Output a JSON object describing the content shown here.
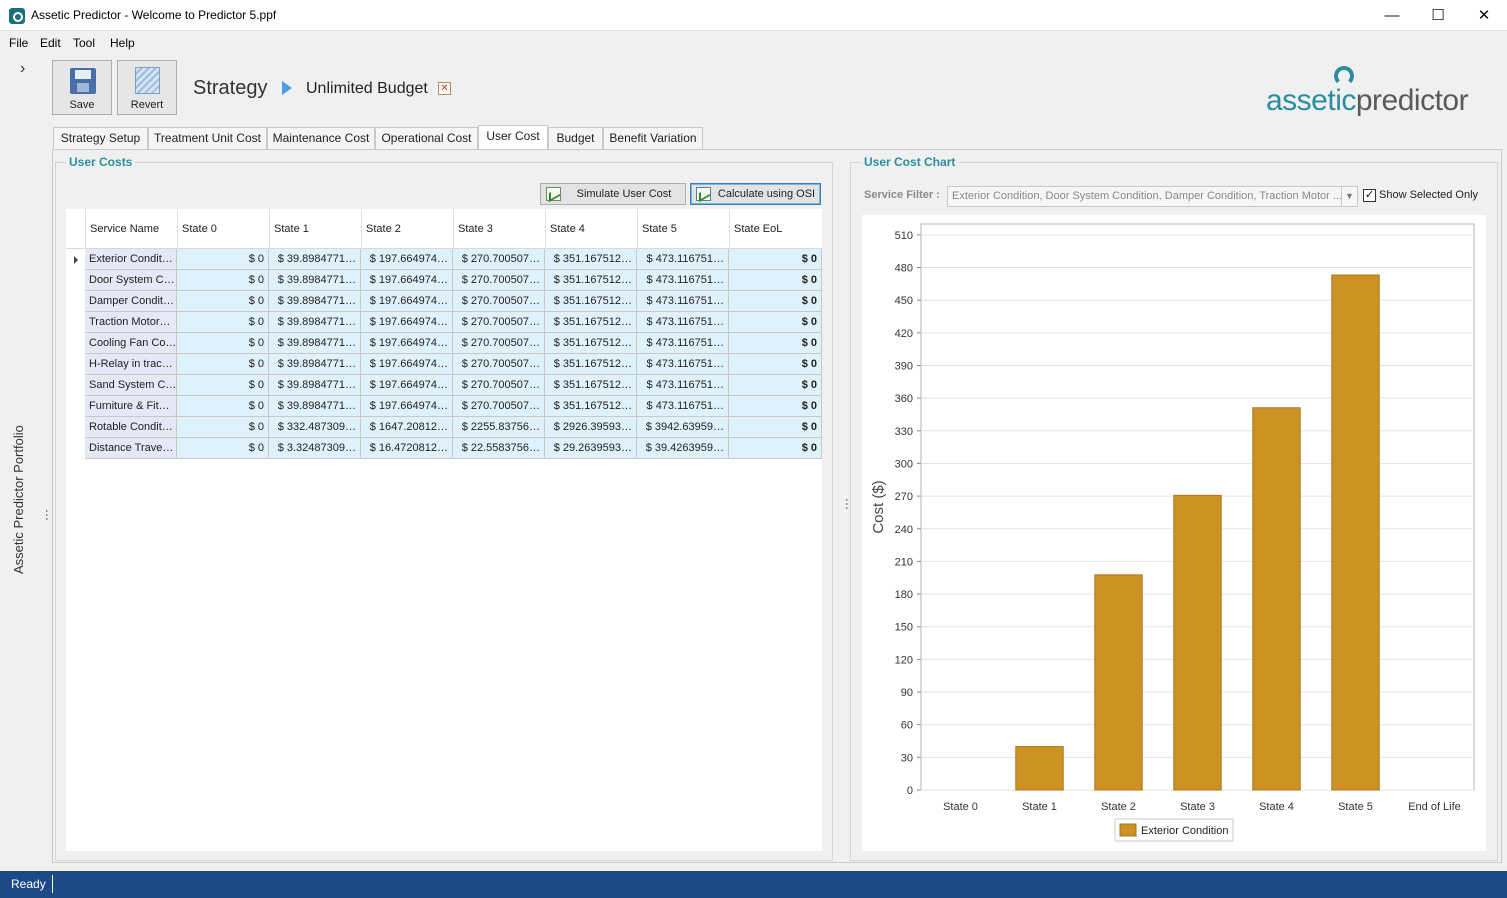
{
  "window": {
    "title": "Assetic Predictor - Welcome to Predictor 5.ppf"
  },
  "menu": [
    "File",
    "Edit",
    "Tool",
    "Help"
  ],
  "left_rail": {
    "label": "Assetic Predictor Portfolio"
  },
  "toolbar": {
    "save_label": "Save",
    "revert_label": "Revert"
  },
  "breadcrumb": {
    "level1": "Strategy",
    "level2": "Unlimited Budget"
  },
  "logo": {
    "part1": "assetic",
    "part2": "predictor"
  },
  "tabs": [
    "Strategy Setup",
    "Treatment Unit Cost",
    "Maintenance Cost",
    "Operational Cost",
    "User Cost",
    "Budget",
    "Benefit Variation"
  ],
  "active_tab": "User Cost",
  "user_costs": {
    "title": "User Costs",
    "simulate_label": "Simulate User Cost",
    "calculate_label": "Calculate using OSI",
    "columns": [
      "Service Name",
      "State 0",
      "State 1",
      "State 2",
      "State 3",
      "State 4",
      "State 5",
      "State EoL"
    ],
    "rows": [
      [
        "Exterior Condit…",
        "$ 0",
        "$ 39.8984771…",
        "$ 197.664974…",
        "$ 270.700507…",
        "$ 351.167512…",
        "$ 473.116751…",
        "$ 0"
      ],
      [
        "Door System C…",
        "$ 0",
        "$ 39.8984771…",
        "$ 197.664974…",
        "$ 270.700507…",
        "$ 351.167512…",
        "$ 473.116751…",
        "$ 0"
      ],
      [
        "Damper Condit…",
        "$ 0",
        "$ 39.8984771…",
        "$ 197.664974…",
        "$ 270.700507…",
        "$ 351.167512…",
        "$ 473.116751…",
        "$ 0"
      ],
      [
        "Traction Motor…",
        "$ 0",
        "$ 39.8984771…",
        "$ 197.664974…",
        "$ 270.700507…",
        "$ 351.167512…",
        "$ 473.116751…",
        "$ 0"
      ],
      [
        "Cooling Fan Co…",
        "$ 0",
        "$ 39.8984771…",
        "$ 197.664974…",
        "$ 270.700507…",
        "$ 351.167512…",
        "$ 473.116751…",
        "$ 0"
      ],
      [
        "H-Relay in trac…",
        "$ 0",
        "$ 39.8984771…",
        "$ 197.664974…",
        "$ 270.700507…",
        "$ 351.167512…",
        "$ 473.116751…",
        "$ 0"
      ],
      [
        "Sand System C…",
        "$ 0",
        "$ 39.8984771…",
        "$ 197.664974…",
        "$ 270.700507…",
        "$ 351.167512…",
        "$ 473.116751…",
        "$ 0"
      ],
      [
        "Furniture & Fit…",
        "$ 0",
        "$ 39.8984771…",
        "$ 197.664974…",
        "$ 270.700507…",
        "$ 351.167512…",
        "$ 473.116751…",
        "$ 0"
      ],
      [
        "Rotable Condit…",
        "$ 0",
        "$ 332.487309…",
        "$ 1647.20812…",
        "$ 2255.83756…",
        "$ 2926.39593…",
        "$ 3942.63959…",
        "$ 0"
      ],
      [
        "Distance Trave…",
        "$ 0",
        "$ 3.32487309…",
        "$ 16.4720812…",
        "$ 22.5583756…",
        "$ 29.2639593…",
        "$ 39.4263959…",
        "$ 0"
      ]
    ]
  },
  "user_cost_chart": {
    "title": "User Cost Chart",
    "filter_label": "Service Filter :",
    "filter_value": "Exterior Condition, Door System Condition, Damper Condition, Traction Motor ...",
    "show_selected_label": "Show Selected Only",
    "show_selected_checked": true
  },
  "chart_data": {
    "type": "bar",
    "categories": [
      "State 0",
      "State 1",
      "State 2",
      "State 3",
      "State 4",
      "State 5",
      "End of Life"
    ],
    "series": [
      {
        "name": "Exterior Condition",
        "values": [
          0,
          39.9,
          197.66,
          270.7,
          351.17,
          473.12,
          0
        ],
        "color": "#cd9223"
      }
    ],
    "ylabel": "Cost ($)",
    "xlabel": "",
    "ylim": [
      0,
      520
    ],
    "yticks": [
      0,
      30,
      60,
      90,
      120,
      150,
      180,
      210,
      240,
      270,
      300,
      330,
      360,
      390,
      420,
      450,
      480,
      510
    ],
    "grid": true,
    "legend": "bottom"
  },
  "status": {
    "text": "Ready"
  },
  "colors": {
    "accent": "#2a8ea0",
    "statusbar": "#1c4a89",
    "bar": "#cd9223"
  }
}
